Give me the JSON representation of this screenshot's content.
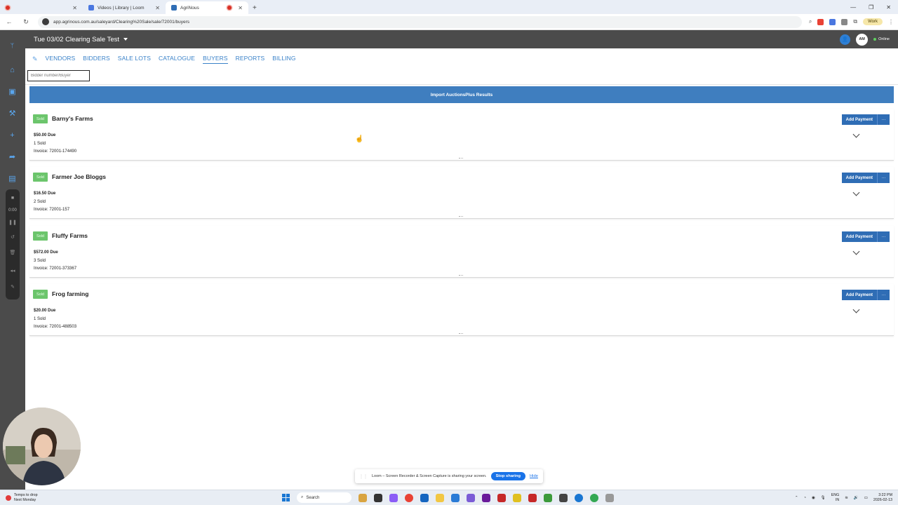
{
  "browser": {
    "tabs": [
      {
        "title": "",
        "kind": "recording"
      },
      {
        "title": "Videos | Library | Loom",
        "kind": "loom"
      },
      {
        "title": "AgriNous",
        "kind": "agrinous"
      }
    ],
    "address": "app.agrinous.com.au/saleyard/Clearing%20Sale/sale/72001/buyers",
    "profile_label": "Work"
  },
  "header": {
    "sale_title": "Tue 03/02 Clearing Sale Test",
    "avatar_initials": "AM",
    "status": "Online"
  },
  "nav": {
    "tabs": [
      "VENDORS",
      "BIDDERS",
      "SALE LOTS",
      "CATALOGUE",
      "BUYERS",
      "REPORTS",
      "BILLING"
    ],
    "active": "BUYERS"
  },
  "search": {
    "placeholder": "Bidder number/Buyer"
  },
  "import_button": "Import AuctionsPlus Results",
  "card_labels": {
    "status": "Sold",
    "add_payment": "Add Payment",
    "more": "···"
  },
  "buyers": [
    {
      "name": "Barny's Farms",
      "due": "$50.00 Due",
      "sold": "1 Sold",
      "invoice": "Invoice: 72001-174490"
    },
    {
      "name": "Farmer Joe Bloggs",
      "due": "$16.50 Due",
      "sold": "2 Sold",
      "invoice": "Invoice: 72001-157"
    },
    {
      "name": "Fluffy Farms",
      "due": "$572.00 Due",
      "sold": "3 Sold",
      "invoice": "Invoice: 72001-373367"
    },
    {
      "name": "Frog farming",
      "due": "$20.00 Due",
      "sold": "1 Sold",
      "invoice": "Invoice: 72001-488503"
    }
  ],
  "recorder": {
    "timer": "0:00"
  },
  "sharebar": {
    "message": "Loom – Screen Recorder & Screen Capture is sharing your screen.",
    "stop": "Stop sharing",
    "hide": "Hide"
  },
  "taskbar": {
    "weather_line1": "Temps to drop",
    "weather_line2": "Next Monday",
    "search_label": "Search",
    "lang_line1": "ENG",
    "lang_line2": "IN",
    "time": "3:22 PM",
    "date": "2026-02-13"
  }
}
